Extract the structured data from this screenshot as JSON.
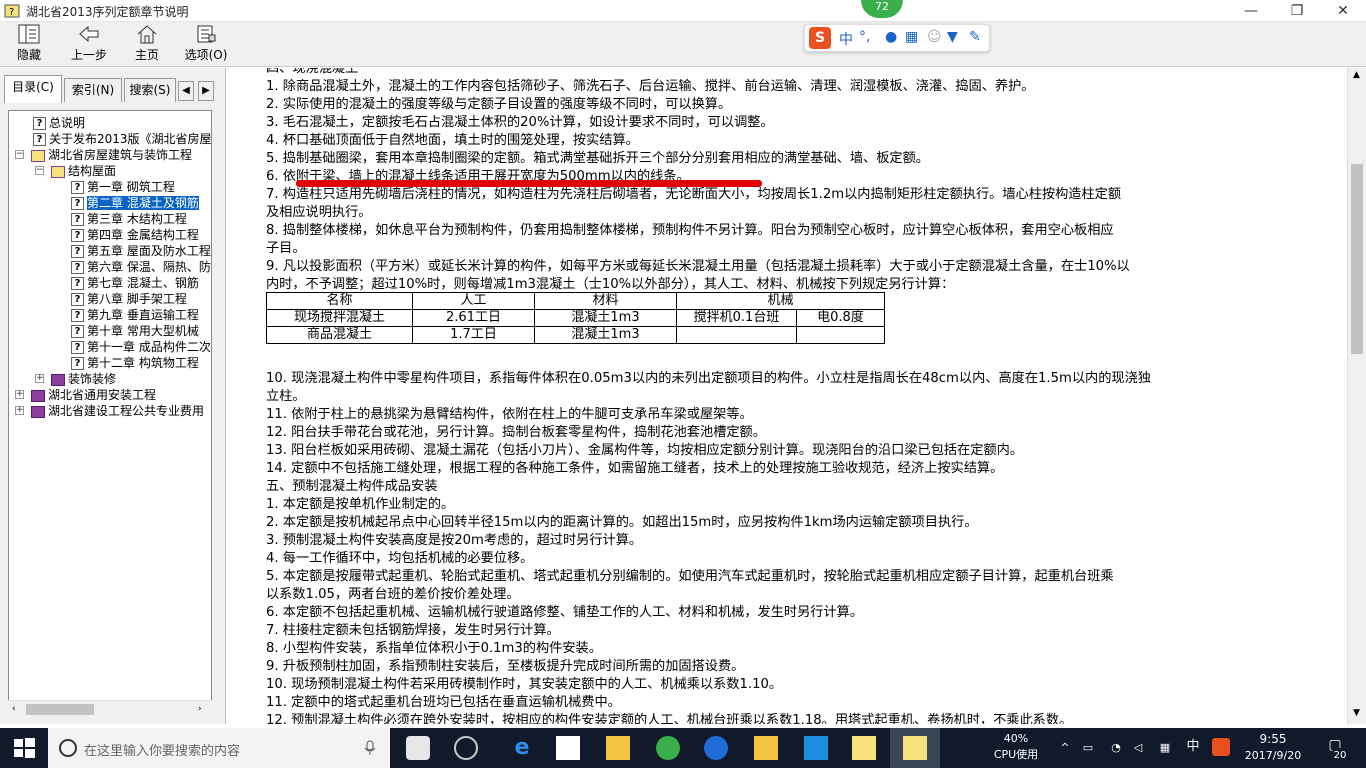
{
  "window": {
    "title": "湖北省2013序列定额章节说明",
    "minimize": "—",
    "restore": "❐",
    "close": "✕"
  },
  "toolbar": {
    "items": [
      {
        "label": "隐藏"
      },
      {
        "label": "上一步"
      },
      {
        "label": "主页"
      },
      {
        "label": "选项(O)"
      }
    ]
  },
  "tabs": {
    "contents": "目录(C)",
    "index": "索引(N)",
    "search": "搜索(S)",
    "prev": "◀",
    "next": "▶"
  },
  "tree": [
    {
      "label": "总说明"
    },
    {
      "label": "关于发布2013版《湖北省房屋"
    },
    {
      "label": "湖北省房屋建筑与装饰工程"
    },
    {
      "label": "结构屋面"
    },
    {
      "label": "第一章 砌筑工程"
    },
    {
      "label": "第二章 混凝土及钢筋"
    },
    {
      "label": "第三章 木结构工程"
    },
    {
      "label": "第四章 金属结构工程"
    },
    {
      "label": "第五章 屋面及防水工程"
    },
    {
      "label": "第六章 保温、隔热、防"
    },
    {
      "label": "第七章 混凝土、钢筋"
    },
    {
      "label": "第八章 脚手架工程"
    },
    {
      "label": "第九章 垂直运输工程"
    },
    {
      "label": "第十章 常用大型机械"
    },
    {
      "label": "第十一章 成品构件二次"
    },
    {
      "label": "第十二章 构筑物工程"
    },
    {
      "label": "装饰装修"
    },
    {
      "label": "湖北省通用安装工程"
    },
    {
      "label": "湖北省建设工程公共专业费用"
    }
  ],
  "content": {
    "lines_top": [
      "四、现浇混凝土",
      "1. 除商品混凝土外，混凝土的工作内容包括筛砂子、筛洗石子、后台运输、搅拌、前台运输、清理、润湿模板、浇灌、捣固、养护。",
      "2. 实际使用的混凝土的强度等级与定额子目设置的强度等级不同时，可以换算。",
      "3. 毛石混凝土，定额按毛石占混凝土体积的20%计算，如设计要求不同时，可以调整。",
      "4. 杯口基础顶面低于自然地面，填土时的围笼处理，按实结算。",
      "5. 捣制基础圈梁，套用本章捣制圈梁的定额。箱式满堂基础拆开三个部分分别套用相应的满堂基础、墙、板定额。",
      "6. 依附于梁、墙上的混凝土线条适用于展开宽度为500mm以内的线条。",
      "7. 构造柱只适用先砌墙后浇柱的情况，如构造柱为先浇柱后砌墙者，无论断面大小，均按周长1.2m以内捣制矩形柱定额执行。墙心柱按构造柱定额",
      "及相应说明执行。",
      "8. 捣制整体楼梯，如休息平台为预制构件，仍套用捣制整体楼梯，预制构件不另计算。阳台为预制空心板时，应计算空心板体积，套用空心板相应",
      "子目。",
      "9. 凡以投影面积（平方米）或延长米计算的构件，如每平方米或每延长米混凝土用量（包括混凝土损耗率）大于或小于定额混凝土含量，在士10%以",
      "内时，不予调整；超过10%时，则每增减1m3混凝土（士10%以外部分），其人工、材料、机械按下列规定另行计算："
    ],
    "table": {
      "headers": [
        "名称",
        "人工",
        "材料",
        "机械"
      ],
      "rows": [
        [
          "现场搅拌混凝土",
          "2.61工日",
          "混凝土1m3",
          "搅拌机0.1台班",
          "电0.8度"
        ],
        [
          "商品混凝土",
          "1.7工日",
          "混凝土1m3",
          "",
          ""
        ]
      ]
    },
    "lines_bottom": [
      "10. 现浇混凝土构件中零星构件项目，系指每件体积在0.05m3以内的未列出定额项目的构件。小立柱是指周长在48cm以内、高度在1.5m以内的现浇独",
      "立柱。",
      "11. 依附于柱上的悬挑梁为悬臂结构件，依附在柱上的牛腿可支承吊车梁或屋架等。",
      "12. 阳台扶手带花台或花池，另行计算。捣制台板套零星构件，捣制花池套池槽定额。",
      "13. 阳台栏板如采用砖砌、混凝土漏花（包括小刀片）、金属构件等，均按相应定额分别计算。现浇阳台的沿口梁已包括在定额内。",
      "14. 定额中不包括施工缝处理，根据工程的各种施工条件，如需留施工缝者，技术上的处理按施工验收规范，经济上按实结算。",
      "五、预制混凝土构件成品安装",
      "1. 本定额是按单机作业制定的。",
      "2. 本定额是按机械起吊点中心回转半径15m以内的距离计算的。如超出15m时，应另按构件1km场内运输定额项目执行。",
      "3. 预制混凝土构件安装高度是按20m考虑的，超过时另行计算。",
      "4. 每一工作循环中，均包括机械的必要位移。",
      "5. 本定额是按履带式起重机、轮胎式起重机、塔式起重机分别编制的。如使用汽车式起重机时，按轮胎式起重机相应定额子目计算，起重机台班乘",
      "以系数1.05，两者台班的差价按价差处理。",
      "6. 本定额不包括起重机械、运输机械行驶道路修整、铺垫工作的人工、材料和机械，发生时另行计算。",
      "7. 柱接柱定额未包括钢筋焊接，发生时另行计算。",
      "8. 小型构件安装，系指单位体积小于0.1m3的构件安装。",
      "9. 升板预制柱加固，系指预制柱安装后，至楼板提升完成时间所需的加固搭设费。",
      "10. 现场预制混凝土构件若采用砖模制作时，其安装定额中的人工、机械乘以系数1.10。",
      "11. 定额中的塔式起重机台班均已包括在垂直运输机械费中。",
      "12. 预制混凝土构件必须在跨外安装时，按相应的构件安装定额的人工、机械台班乘以系数1.18。用塔式起重机、卷扬机时，不乘此系数。"
    ]
  },
  "ime": {
    "badge": "72",
    "lang": "中",
    "punct": "°,",
    "accent": "#1a64c8"
  },
  "taskbar": {
    "search_placeholder": "在这里输入你要搜索的内容",
    "cpu_value": "40%",
    "cpu_label": "CPU使用",
    "ime_lang": "中",
    "time": "9:55",
    "date": "2017/9/20",
    "notif_count": "20"
  }
}
